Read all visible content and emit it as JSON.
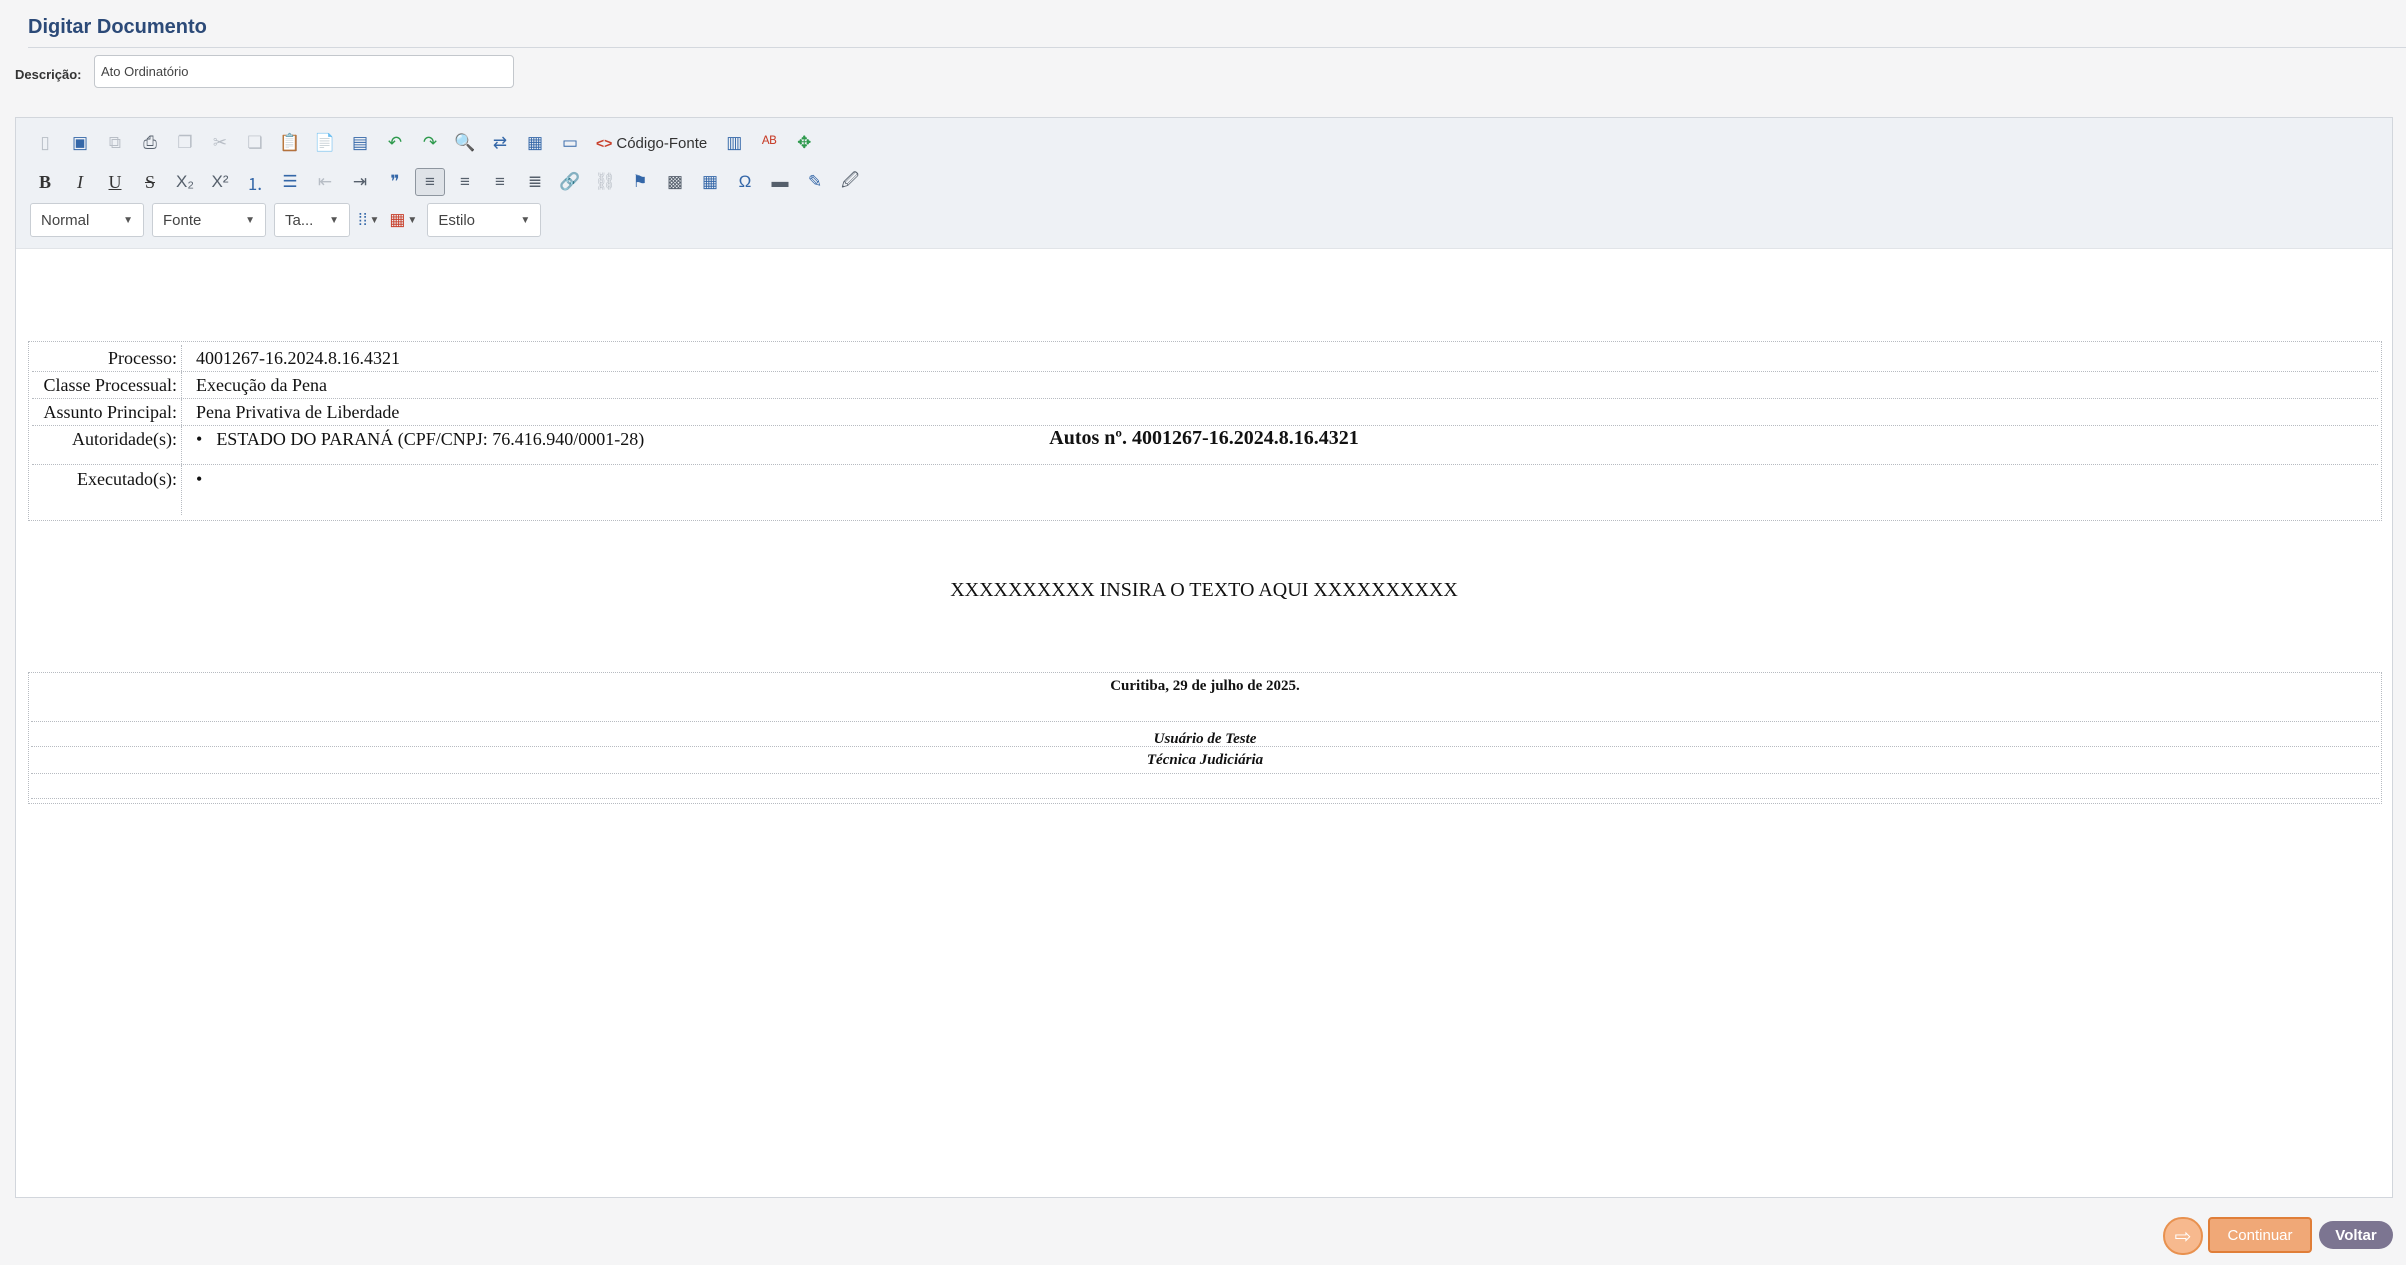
{
  "page": {
    "title": "Digitar Documento"
  },
  "description": {
    "label": "Descrição:",
    "value": "Ato Ordinatório"
  },
  "toolbar": {
    "source_label": "Código-Fonte",
    "format_combo": "Normal",
    "font_combo": "Fonte",
    "size_combo": "Ta...",
    "style_combo": "Estilo"
  },
  "document": {
    "heading": "Autos nº. 4001267-16.2024.8.16.4321",
    "rows": [
      {
        "label": "Processo:",
        "value": "4001267-16.2024.8.16.4321"
      },
      {
        "label": "Classe Processual:",
        "value": "Execução da Pena"
      },
      {
        "label": "Assunto Principal:",
        "value": "Pena Privativa de Liberdade"
      },
      {
        "label": "Autoridade(s):",
        "value": "ESTADO DO PARANÁ (CPF/CNPJ: 76.416.940/0001-28)"
      },
      {
        "label": "Executado(s):",
        "value": ""
      }
    ],
    "placeholder": "XXXXXXXXXX INSIRA O TEXTO AQUI XXXXXXXXXX",
    "signature": {
      "date_line": "Curitiba, 29 de julho de 2025.",
      "name": "Usuário de Teste",
      "role": "Técnica Judiciária"
    }
  },
  "actions": {
    "continue_label": "Continuar",
    "back_label": "Voltar"
  }
}
